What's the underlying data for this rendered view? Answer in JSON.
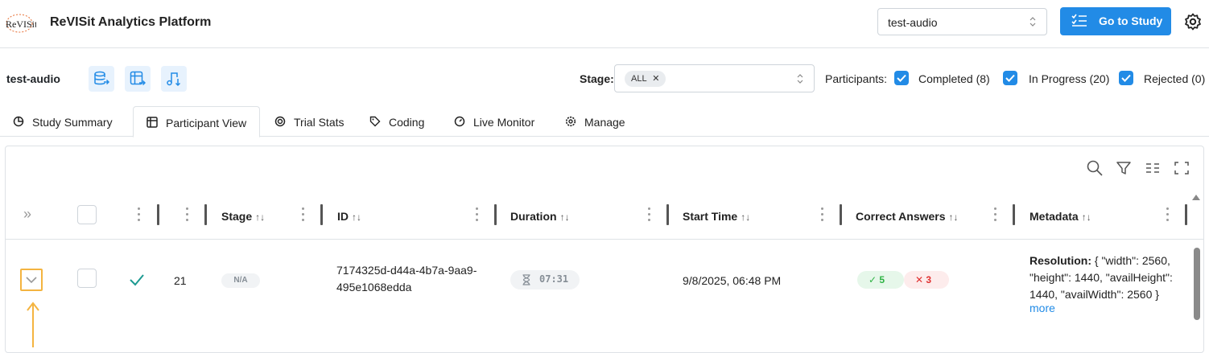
{
  "header": {
    "logo_text": "ReVISit",
    "app_title": "ReVISit Analytics Platform",
    "study_select_value": "test-audio",
    "go_button_label": "Go to Study",
    "colors": {
      "accent": "#228be6",
      "highlight": "#f4b440"
    }
  },
  "study_bar": {
    "study_name": "test-audio",
    "tool_icons": [
      "database-export-icon",
      "table-export-icon",
      "audio-download-icon"
    ],
    "stage_label": "Stage:",
    "stage_value": "ALL",
    "participants_label": "Participants:",
    "filters": [
      {
        "label": "Completed (8)",
        "checked": true
      },
      {
        "label": "In Progress (20)",
        "checked": true
      },
      {
        "label": "Rejected (0)",
        "checked": true
      }
    ]
  },
  "tabs": [
    {
      "label": "Study Summary",
      "icon": "chart-pie-icon",
      "active": false
    },
    {
      "label": "Participant View",
      "icon": "table-icon",
      "active": true
    },
    {
      "label": "Trial Stats",
      "icon": "target-icon",
      "active": false
    },
    {
      "label": "Coding",
      "icon": "tag-icon",
      "active": false
    },
    {
      "label": "Live Monitor",
      "icon": "gauge-icon",
      "active": false
    },
    {
      "label": "Manage",
      "icon": "settings-icon",
      "active": false
    }
  ],
  "table": {
    "toolbar_icons": [
      "search-icon",
      "filter-icon",
      "columns-icon",
      "fullscreen-icon"
    ],
    "expand_all_glyph": "»",
    "columns": {
      "stage": "Stage",
      "id": "ID",
      "duration": "Duration",
      "start_time": "Start Time",
      "correct_answers": "Correct Answers",
      "metadata": "Metadata",
      "sort_glyph": "↑↓"
    },
    "row": {
      "status_icon": "check-icon",
      "index": "21",
      "stage": "N/A",
      "id_line1": "7174325d-d44a-4b7a-9aa9-",
      "id_line2": "495e1068edda",
      "duration": "07:31",
      "start_time": "9/8/2025, 06:48 PM",
      "correct": "5",
      "incorrect": "3",
      "metadata_label": "Resolution:",
      "metadata_value": " { \"width\": 2560, \"height\": 1440, \"availHeight\": 1440, \"availWidth\": 2560 }",
      "more_link": "more"
    }
  }
}
